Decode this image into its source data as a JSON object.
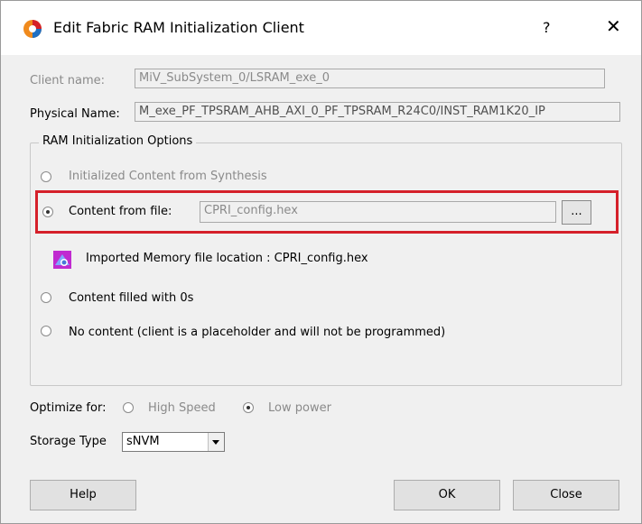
{
  "window": {
    "title": "Edit Fabric RAM Initialization Client",
    "help_label": "?",
    "close_label": "✕"
  },
  "client": {
    "name_label": "Client name:",
    "name_value": "MiV_SubSystem_0/LSRAM_exe_0",
    "physical_label": "Physical Name:",
    "physical_value": "M_exe_PF_TPSRAM_AHB_AXI_0_PF_TPSRAM_R24C0/INST_RAM1K20_IP"
  },
  "options": {
    "group_title": "RAM Initialization Options",
    "synthesis_label": "Initialized Content from Synthesis",
    "file_label": "Content from file:",
    "file_value": "CPRI_config.hex",
    "browse_label": "...",
    "imported_text": "Imported Memory file location : CPRI_config.hex",
    "zeros_label": "Content filled with 0s",
    "none_label": "No content (client is a placeholder and will not be programmed)",
    "selected": "file"
  },
  "optimize": {
    "label": "Optimize for:",
    "high_speed": "High Speed",
    "low_power": "Low power",
    "selected": "low_power"
  },
  "storage": {
    "label": "Storage Type",
    "value": "sNVM"
  },
  "buttons": {
    "help": "Help",
    "ok": "OK",
    "close": "Close"
  },
  "colors": {
    "highlight": "#d5202a",
    "dialog_bg": "#f0f0f0"
  }
}
